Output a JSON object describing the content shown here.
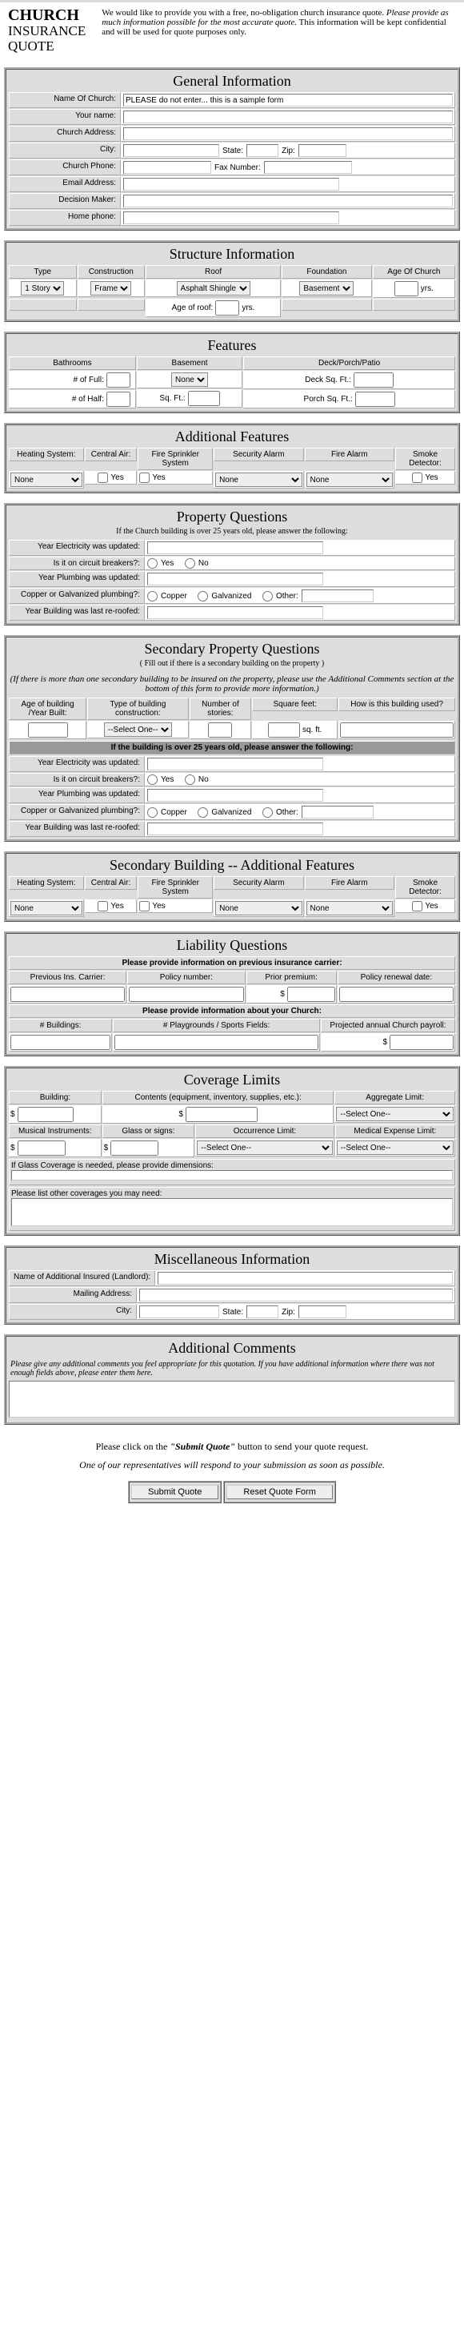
{
  "header": {
    "title1": "CHURCH",
    "title2": "INSURANCE",
    "title3": "QUOTE",
    "intro_a": "We would like to provide you with a free, no-obligation church insurance quote. ",
    "intro_b": "Please provide as much information possible for the most accurate quote.",
    "intro_c": " This information will be kept confidential and will be used for quote purposes only."
  },
  "gen": {
    "title": "General Information",
    "l_name": "Name Of Church:",
    "v_name": "PLEASE do not enter... this is a sample form",
    "l_your": "Your name:",
    "l_addr": "Church Address:",
    "l_city": "City:",
    "l_state": "State:",
    "l_zip": "Zip:",
    "l_phone": "Church Phone:",
    "l_fax": "Fax Number:",
    "l_email": "Email Address:",
    "l_dm": "Decision Maker:",
    "l_home": "Home phone:"
  },
  "struct": {
    "title": "Structure Information",
    "h_type": "Type",
    "h_const": "Construction",
    "h_roof": "Roof",
    "h_found": "Foundation",
    "h_age": "Age Of Church",
    "v_type": "1 Story",
    "v_const": "Frame",
    "v_roof": "Asphalt Shingle",
    "v_found": "Basement",
    "yrs": "yrs.",
    "ageroof": "Age of roof:"
  },
  "feat": {
    "title": "Features",
    "h_bath": "Bathrooms",
    "h_base": "Basement",
    "h_deck": "Deck/Porch/Patio",
    "l_full": "# of Full:",
    "l_half": "# of Half:",
    "v_base": "None",
    "l_sqft": "Sq. Ft.:",
    "l_dsq": "Deck Sq. Ft.:",
    "l_psq": "Porch Sq. Ft.:"
  },
  "addfeat": {
    "title": "Additional Features",
    "h_heat": "Heating System:",
    "h_air": "Central Air:",
    "h_fire": "Fire Sprinkler System",
    "h_sec": "Security Alarm",
    "h_fa": "Fire Alarm",
    "h_smoke": "Smoke Detector:",
    "v_none": "None",
    "yes": "Yes"
  },
  "prop": {
    "title": "Property Questions",
    "sub": "If the Church building is over 25 years old, please answer the following:",
    "l1": "Year Electricity was updated:",
    "l2": "Is it on circuit breakers?:",
    "l3": "Year Plumbing was updated:",
    "l4": "Copper or Galvanized plumbing?:",
    "l5": "Year Building was last re-roofed:",
    "yes": "Yes",
    "no": "No",
    "copper": "Copper",
    "galv": "Galvanized",
    "other": "Other:"
  },
  "sec": {
    "title": "Secondary Property Questions",
    "sub": "( Fill out if there is a secondary building on the property )",
    "note": "(If there is more than one secondary building to be insured on the property, please use the Additional Comments section at the bottom of this form to provide more information.)",
    "h1": "Age of building /Year Built:",
    "h2": "Type of building construction:",
    "h3": "Number of stories:",
    "h4": "Square feet:",
    "h5": "How is this building used?",
    "v2": "--Select One--",
    "sqft": "sq. ft.",
    "bar": "If the building is over 25 years old, please answer the following:"
  },
  "sec2": {
    "title": "Secondary Building -- Additional Features"
  },
  "liab": {
    "title": "Liability Questions",
    "bar1": "Please provide information on previous insurance carrier:",
    "h_prev": "Previous Ins. Carrier:",
    "h_pol": "Policy number:",
    "h_pp": "Prior premium:",
    "h_ren": "Policy renewal date:",
    "dollar": "$",
    "bar2": "Please provide information about your Church:",
    "h_bld": "# Buildings:",
    "h_pg": "# Playgrounds / Sports Fields:",
    "h_pay": "Projected annual Church payroll:"
  },
  "cov": {
    "title": "Coverage Limits",
    "h_bld": "Building:",
    "h_cont": "Contents (equipment, inventory, supplies, etc.):",
    "h_agg": "Aggregate Limit:",
    "v_sel": "--Select One--",
    "h_mus": "Musical Instruments:",
    "h_glass": "Glass or signs:",
    "h_occ": "Occurrence Limit:",
    "h_med": "Medical Expense Limit:",
    "glass_note": "If Glass Coverage is needed, please provide dimensions:",
    "list_note": "Please list other coverages you may need:"
  },
  "misc": {
    "title": "Miscellaneous Information",
    "l1": "Name of Additional Insured (Landlord):",
    "l2": "Mailing Address:",
    "l3": "City:",
    "l_state": "State:",
    "l_zip": "Zip:"
  },
  "addc": {
    "title": "Additional Comments",
    "note": "Please give any additional comments you feel appropriate for this quotation. If you have additional information where there was not enough fields above, please enter them here."
  },
  "foot": {
    "t1a": "Please click on the ",
    "t1b": "\"Submit Quote\"",
    "t1c": " button to send your quote request.",
    "t2": "One of our representatives will respond to your submission as soon as possible.",
    "b1": "Submit Quote",
    "b2": "Reset Quote Form"
  }
}
